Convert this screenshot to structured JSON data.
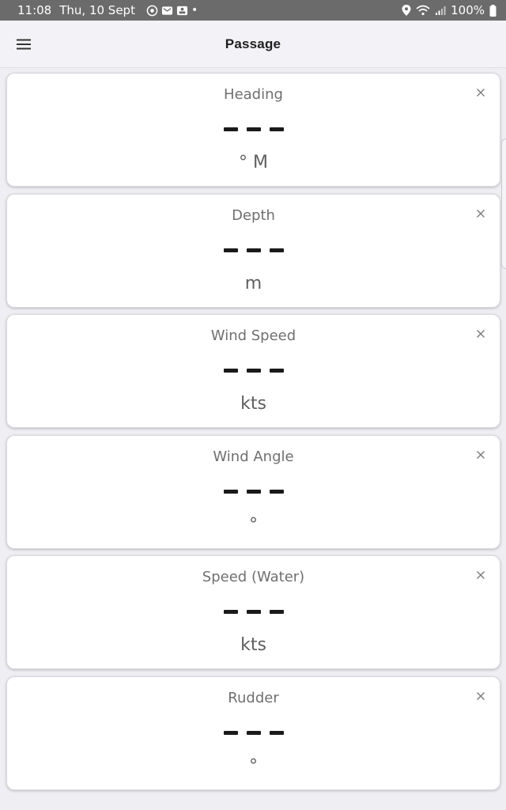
{
  "status_bar": {
    "time": "11:08",
    "date": "Thu, 10 Sept",
    "battery": "100%"
  },
  "app_bar": {
    "title": "Passage"
  },
  "cards": [
    {
      "label": "Heading",
      "value": "- - -",
      "unit": "° M"
    },
    {
      "label": "Depth",
      "value": "- - -",
      "unit": "m"
    },
    {
      "label": "Wind Speed",
      "value": "- - -",
      "unit": "kts"
    },
    {
      "label": "Wind Angle",
      "value": "- - -",
      "unit": "°"
    },
    {
      "label": "Speed (Water)",
      "value": "- - -",
      "unit": "kts"
    },
    {
      "label": "Rudder",
      "value": "- - -",
      "unit": "°"
    }
  ],
  "icons": {
    "menu": "menu-icon",
    "close": "close-icon",
    "location": "location-icon",
    "wifi": "wifi-icon",
    "signal": "signal-icon",
    "battery": "battery-icon"
  },
  "colors": {
    "status_bar": "#6b6b6b",
    "background": "#eeeef3",
    "card": "#ffffff",
    "value": "#1a1a1a"
  }
}
